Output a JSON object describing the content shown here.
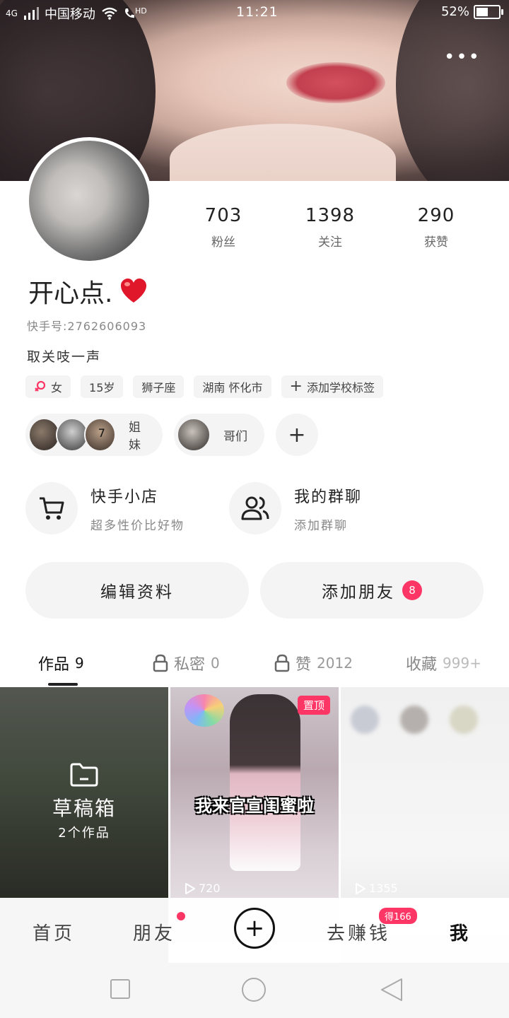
{
  "status_bar": {
    "network": "4G",
    "carrier": "中国移动",
    "hd": "HD",
    "time": "11:21",
    "battery": "52%",
    "battery_level": 0.52
  },
  "profile": {
    "stats": [
      {
        "value": "703",
        "label": "粉丝"
      },
      {
        "value": "1398",
        "label": "关注"
      },
      {
        "value": "290",
        "label": "获赞"
      }
    ],
    "name": "开心点.",
    "kuaishou_id": "快手号:2762606093",
    "bio": "取关吱一声",
    "tags": [
      {
        "text": "女",
        "icon": "female-icon"
      },
      {
        "text": "15岁"
      },
      {
        "text": "狮子座"
      },
      {
        "text": "湖南 怀化市"
      },
      {
        "text": "添加学校标签",
        "icon": "plus-icon"
      }
    ],
    "groups": [
      {
        "label": "姐妹",
        "badge": "7"
      },
      {
        "label": "哥们"
      }
    ]
  },
  "features": [
    {
      "title": "快手小店",
      "subtitle": "超多性价比好物",
      "icon": "cart-icon"
    },
    {
      "title": "我的群聊",
      "subtitle": "添加群聊",
      "icon": "group-chat-icon"
    }
  ],
  "actions": {
    "edit_profile": "编辑资料",
    "add_friend": "添加朋友",
    "add_friend_badge": "8"
  },
  "tabs": [
    {
      "label": "作品",
      "count": "9",
      "locked": false,
      "active": true
    },
    {
      "label": "私密",
      "count": "0",
      "locked": true
    },
    {
      "label": "赞",
      "count": "2012",
      "locked": true
    },
    {
      "label": "收藏",
      "count": "999+",
      "locked": false
    }
  ],
  "grid": {
    "drafts_title": "草稿箱",
    "drafts_count": "2个作品",
    "video2_pin": "置顶",
    "video2_caption": "我来官宣闺蜜啦",
    "video2_plays": "720",
    "video3_plays": "1355"
  },
  "bottom_nav": {
    "home": "首页",
    "friends": "朋友",
    "earn": "去赚钱",
    "earn_badge": "得166",
    "me": "我"
  }
}
